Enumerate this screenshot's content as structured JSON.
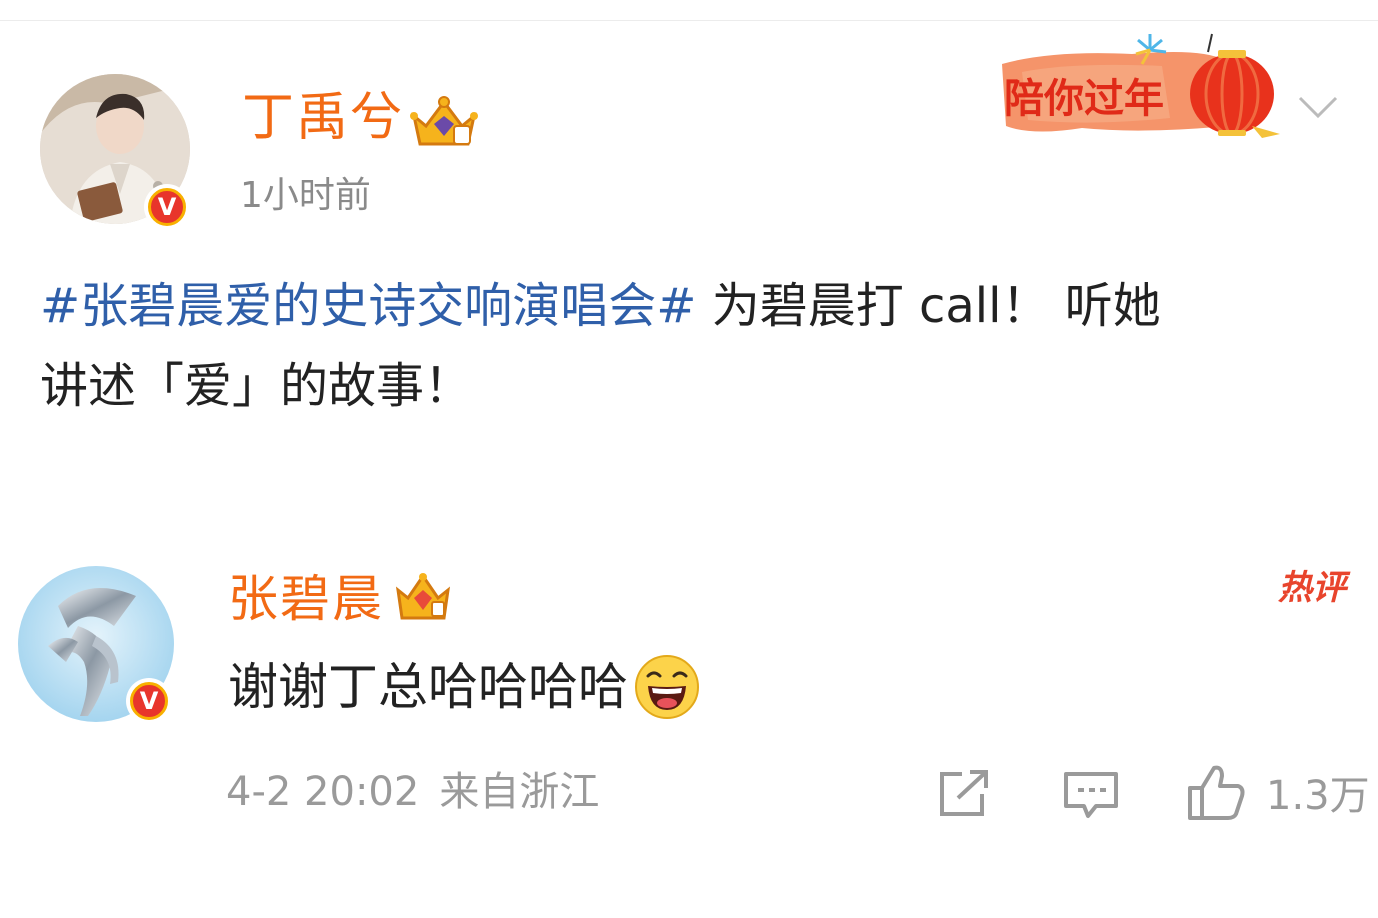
{
  "post": {
    "author": "丁禹兮",
    "time": "1小时前",
    "banner_text": "陪你过年",
    "hashtag": "#张碧晨爱的史诗交响演唱会#",
    "body_line1_rest": " 为碧晨打 call！ 听她",
    "body_line2": "讲述「爱」的故事！"
  },
  "comment": {
    "author": "张碧晨",
    "hot_label": "热评",
    "text": "谢谢丁总哈哈哈哈",
    "date": "4-2 20:02",
    "location": "来自浙江",
    "like_count": "1.3万"
  },
  "badges": {
    "verified": "V"
  },
  "icons": {
    "repost": "share-square-icon",
    "comment": "comment-bubble-icon",
    "like": "thumbs-up-icon",
    "expand": "chevron-down-icon"
  },
  "colors": {
    "username": "#f26a14",
    "hashtag": "#2f5fa9",
    "meta": "#9a9a9a",
    "hot": "#e8442c",
    "verified": "#e8352b"
  }
}
